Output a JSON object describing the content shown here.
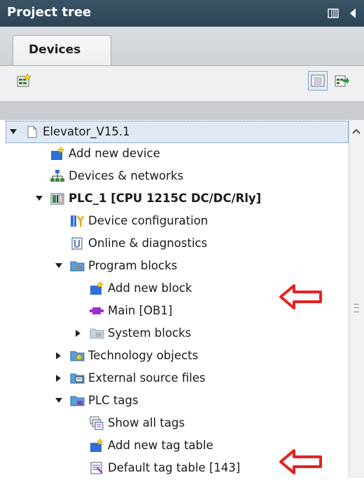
{
  "window": {
    "title": "Project tree"
  },
  "tabs": [
    {
      "label": "Devices",
      "active": true
    }
  ],
  "tree": [
    {
      "label": "Elevator_V15.1",
      "icon": "project-file-icon",
      "expanded": true,
      "level": 0,
      "selected": true
    },
    {
      "label": "Add new device",
      "icon": "add-new-device-icon",
      "level": 1
    },
    {
      "label": "Devices & networks",
      "icon": "devices-networks-icon",
      "level": 1
    },
    {
      "label": "PLC_1 [CPU 1215C DC/DC/Rly]",
      "icon": "plc-icon",
      "expanded": true,
      "level": 1
    },
    {
      "label": "Device configuration",
      "icon": "device-configuration-icon",
      "level": 2
    },
    {
      "label": "Online & diagnostics",
      "icon": "online-diagnostics-icon",
      "level": 2
    },
    {
      "label": "Program blocks",
      "icon": "folder-icon",
      "expanded": true,
      "level": 2
    },
    {
      "label": "Add new block",
      "icon": "add-new-block-icon",
      "level": 3
    },
    {
      "label": "Main [OB1]",
      "icon": "ob-block-icon",
      "level": 3
    },
    {
      "label": "System blocks",
      "icon": "folder-icon",
      "expanded": false,
      "level": 3
    },
    {
      "label": "Technology objects",
      "icon": "technology-objects-icon",
      "expanded": false,
      "level": 2
    },
    {
      "label": "External source files",
      "icon": "external-source-icon",
      "expanded": false,
      "level": 2
    },
    {
      "label": "PLC tags",
      "icon": "folder-icon",
      "expanded": true,
      "level": 2
    },
    {
      "label": "Show all tags",
      "icon": "show-tags-icon",
      "level": 3
    },
    {
      "label": "Add new tag table",
      "icon": "add-tag-table-icon",
      "level": 3
    },
    {
      "label": "Default tag table [143]",
      "icon": "tag-table-icon",
      "level": 3
    }
  ],
  "colors": {
    "annotation_arrow": "#e8211f",
    "titlebar": "#34505f",
    "selection": "#dfe9f5"
  }
}
